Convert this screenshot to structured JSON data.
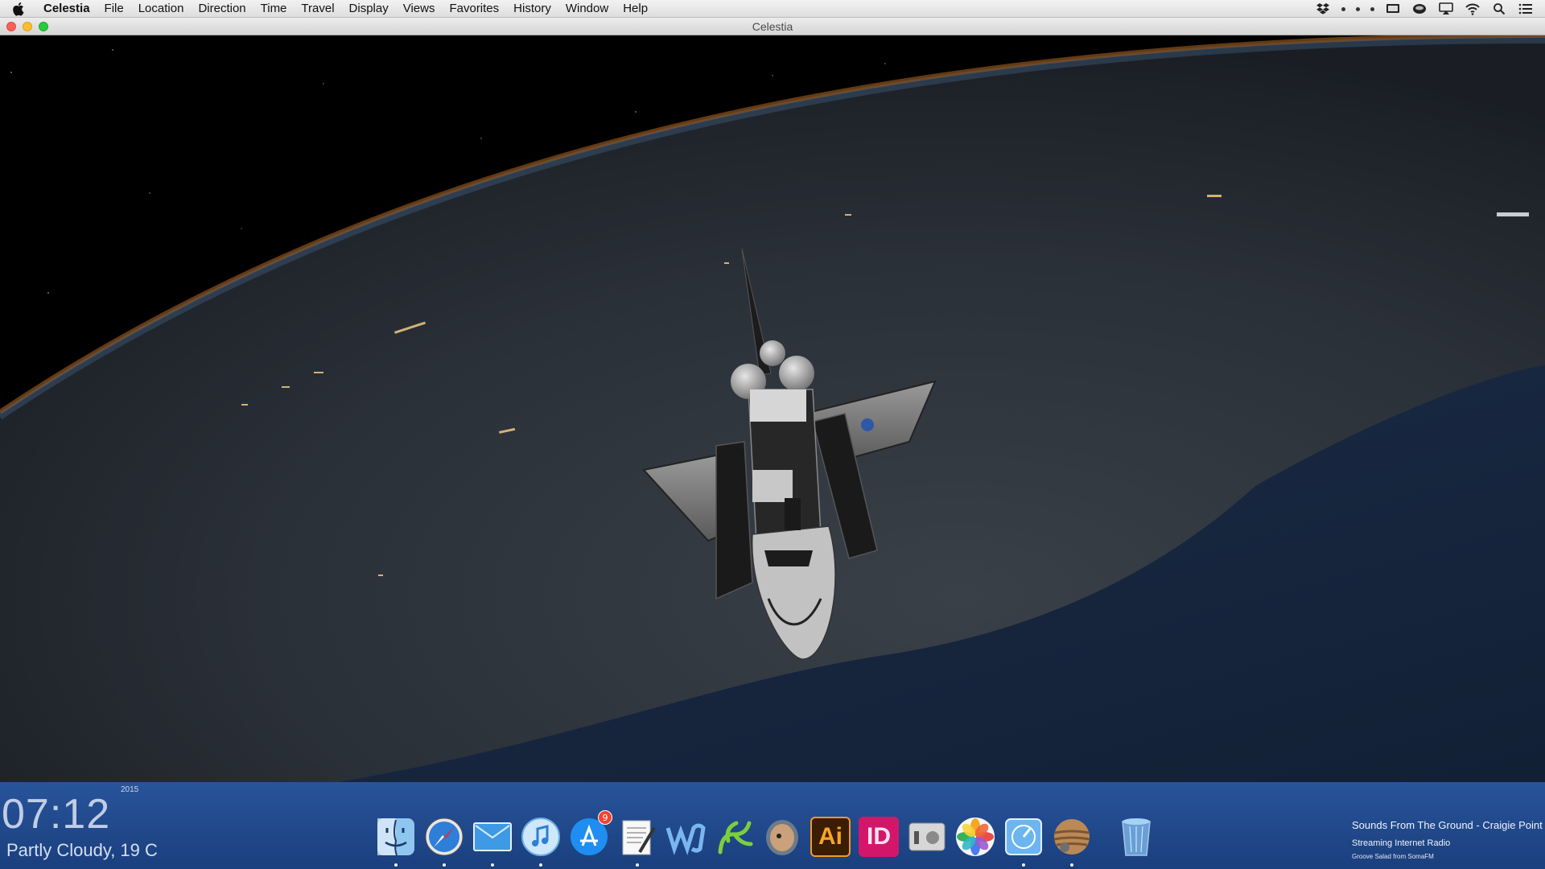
{
  "menubar": {
    "apple_icon": "apple-logo-icon",
    "app_name": "Celestia",
    "items": [
      "File",
      "Location",
      "Direction",
      "Time",
      "Travel",
      "Display",
      "Views",
      "Favorites",
      "History",
      "Window",
      "Help"
    ],
    "status_icons": [
      "dropbox-icon",
      "dot-icon",
      "dot-icon",
      "dot-icon",
      "display-icon",
      "helmet-icon",
      "airplay-icon",
      "wifi-icon",
      "spotlight-search-icon",
      "notification-center-icon"
    ]
  },
  "window": {
    "title": "Celestia",
    "scene": "space-shuttle-orbiting-earth"
  },
  "desktop": {
    "clock_year": "2015",
    "clock_time": "07:12",
    "weather": "Partly Cloudy, 19 C"
  },
  "dock": {
    "apps": [
      {
        "name": "finder-icon",
        "running": true
      },
      {
        "name": "safari-icon",
        "running": true
      },
      {
        "name": "mail-icon",
        "running": true
      },
      {
        "name": "itunes-icon",
        "running": true
      },
      {
        "name": "app-store-icon",
        "badge": "9",
        "running": false
      },
      {
        "name": "textedit-icon",
        "running": true
      },
      {
        "name": "word-icon",
        "running": false
      },
      {
        "name": "app-leaf-icon",
        "running": false
      },
      {
        "name": "preview-icon",
        "running": false
      },
      {
        "name": "illustrator-icon",
        "label": "Ai",
        "running": false
      },
      {
        "name": "indesign-icon",
        "label": "ID",
        "running": false
      },
      {
        "name": "system-info-icon",
        "running": false
      },
      {
        "name": "photos-icon",
        "running": false
      },
      {
        "name": "instruments-icon",
        "running": true
      },
      {
        "name": "celestia-icon",
        "running": true
      },
      {
        "name": "trash-icon",
        "running": false
      }
    ]
  },
  "now_playing": {
    "title": "Sounds From The Ground - Craigie Point",
    "subtitle": "Streaming Internet Radio",
    "source": "Groove Salad from SomaFM"
  }
}
